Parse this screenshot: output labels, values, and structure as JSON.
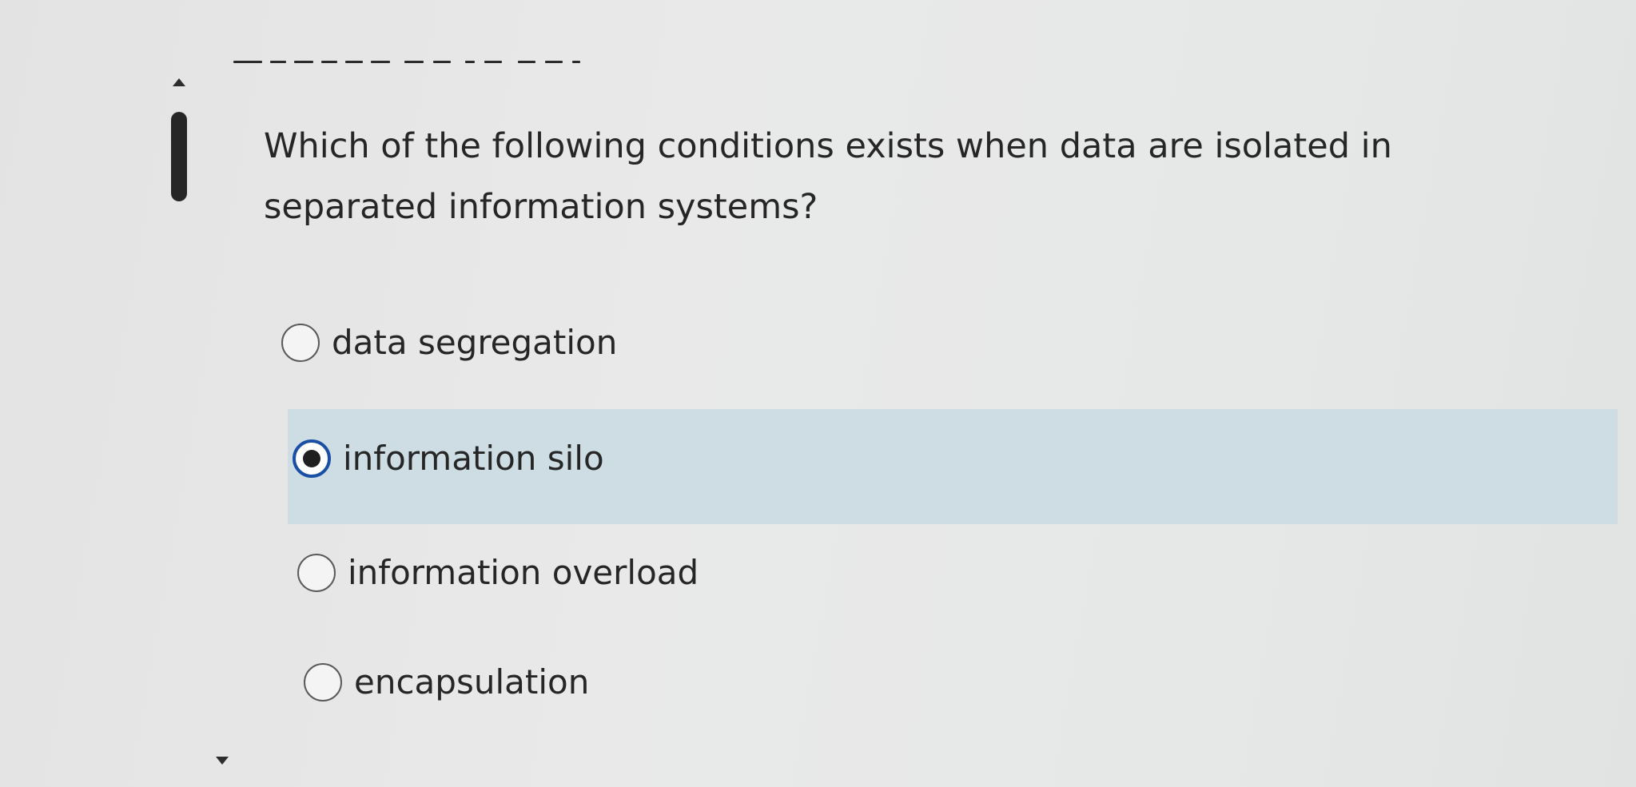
{
  "question": {
    "text": "Which of the following conditions exists when data are isolated in separated information systems?"
  },
  "options": [
    {
      "label": "data segregation",
      "selected": false
    },
    {
      "label": "information silo",
      "selected": true
    },
    {
      "label": "information overload",
      "selected": false
    },
    {
      "label": "encapsulation",
      "selected": false
    }
  ],
  "colors": {
    "background": "#e6e6e6",
    "selected_highlight": "#cddde3",
    "radio_checked_ring": "#1b4fa5",
    "text": "#262626"
  },
  "icons": {
    "scroll_up": "triangle-up-icon",
    "scroll_down": "triangle-down-icon",
    "radio_unchecked": "radio-empty-icon",
    "radio_checked": "radio-filled-icon"
  }
}
